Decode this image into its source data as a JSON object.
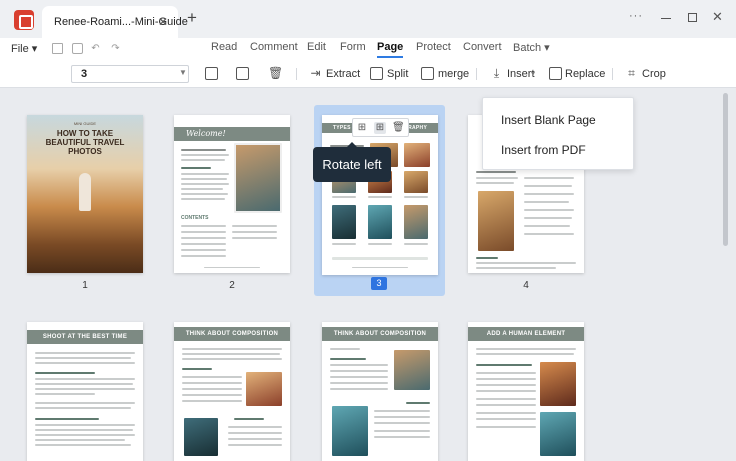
{
  "window": {
    "tab_title": "Renee-Roami...-Mini-Guide",
    "tab_close": "✕",
    "new_tab": "+",
    "more": "···",
    "close": "✕"
  },
  "menu": {
    "file": "File ▾",
    "tabs": [
      "Read",
      "Comment",
      "Edit",
      "Form",
      "Page",
      "Protect",
      "Convert",
      "Batch ▾"
    ],
    "active_tab": "Page"
  },
  "toolbar": {
    "page_value": "3",
    "extract": "Extract",
    "split": "Split",
    "merge": "merge",
    "insert": "Insert",
    "insert_caret": "▾",
    "replace": "Replace",
    "crop": "Crop"
  },
  "insert_menu": {
    "items": [
      "Insert Blank Page",
      "Insert from PDF"
    ]
  },
  "tooltip": {
    "text": "Rotate left"
  },
  "pages": {
    "labels": [
      "1",
      "2",
      "3",
      "4"
    ],
    "p1": {
      "small": "MINI GUIDE",
      "title": "HOW TO TAKE BEAUTIFUL TRAVEL PHOTOS"
    },
    "p2": {
      "banner": "Welcome!",
      "contents": "CONTENTS"
    },
    "p3": {
      "banner": "TYPES OF TRAVEL PHOTOGRAPHY"
    },
    "p5": {
      "banner": "SHOOT AT THE BEST TIME"
    },
    "p6": {
      "banner": "THINK ABOUT COMPOSITION"
    },
    "p7": {
      "banner": "THINK ABOUT COMPOSITION"
    },
    "p8": {
      "banner": "ADD A HUMAN ELEMENT"
    }
  },
  "colors": {
    "accent": "#2e7be2",
    "banner": "#7d8a83",
    "tooltip_bg": "#1f2d3b",
    "selection": "#bad3f3"
  }
}
